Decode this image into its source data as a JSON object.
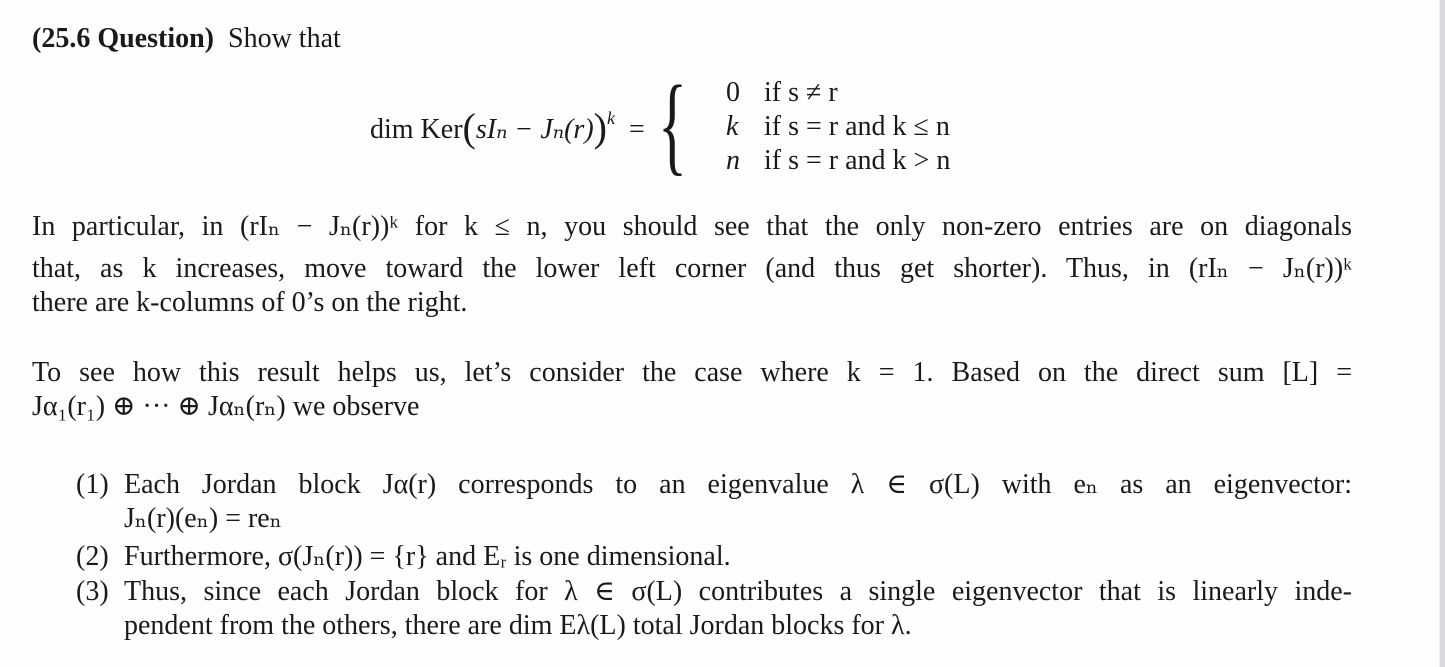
{
  "question": {
    "label": "(25.6 Question)",
    "intro": "Show that"
  },
  "equation": {
    "lhs_prefix": "dim Ker",
    "lhs_body": "sIₙ − Jₙ(r)",
    "exponent": "k",
    "equals": "=",
    "cases": [
      {
        "value": "0",
        "condition": "if s ≠ r"
      },
      {
        "value": "k",
        "condition": "if s = r and k ≤ n"
      },
      {
        "value": "n",
        "condition": "if s = r and k > n"
      }
    ]
  },
  "paragraph1": {
    "lines": [
      "In particular, in (rIₙ − Jₙ(r))ᵏ for k ≤ n, you should see that the only non-zero entries are on diagonals",
      "that, as k increases, move toward the lower left corner (and thus get shorter).  Thus, in (rIₙ − Jₙ(r))ᵏ",
      "there are k-columns of 0’s on the right."
    ]
  },
  "paragraph2": {
    "lines": [
      "To see how this result helps us, let’s consider the case where k = 1.  Based on the direct sum [L] =",
      "Jα₁(r₁) ⊕ ··· ⊕ Jαₙ(rₙ) we observe"
    ]
  },
  "list": [
    {
      "number": "(1)",
      "lines": [
        "Each Jordan block Jα(r) corresponds to an eigenvalue λ ∈ σ(L) with eₙ as an eigenvector:",
        "Jₙ(r)(eₙ) = reₙ"
      ]
    },
    {
      "number": "(2)",
      "lines": [
        "Furthermore, σ(Jₙ(r)) = {r} and Eᵣ is one dimensional."
      ]
    },
    {
      "number": "(3)",
      "lines": [
        "Thus, since each Jordan block for λ ∈ σ(L) contributes a single eigenvector that is linearly inde-",
        "pendent from the others, there are dim Eλ(L) total Jordan blocks for λ."
      ]
    }
  ]
}
